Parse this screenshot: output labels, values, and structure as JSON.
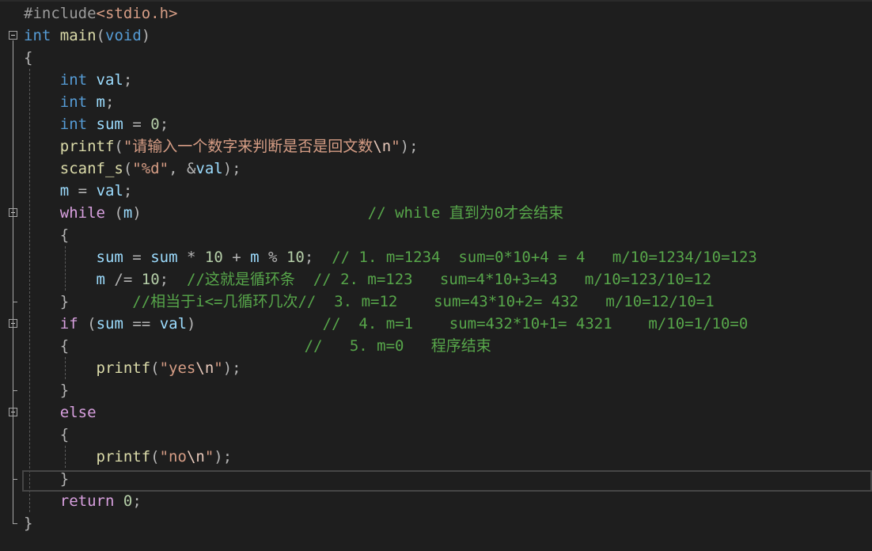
{
  "editor": {
    "language": "C",
    "lines": [
      {
        "seg": [
          [
            "pp",
            "#include"
          ],
          [
            "inc",
            "<stdio.h>"
          ]
        ]
      },
      {
        "seg": [
          [
            "kw",
            "int"
          ],
          [
            "txt",
            " "
          ],
          [
            "fn",
            "main"
          ],
          [
            "punc",
            "("
          ],
          [
            "kw",
            "void"
          ],
          [
            "punc",
            ")"
          ]
        ]
      },
      {
        "seg": [
          [
            "punc",
            "{"
          ]
        ]
      },
      {
        "seg": [
          [
            "txt",
            "    "
          ],
          [
            "kw",
            "int"
          ],
          [
            "txt",
            " "
          ],
          [
            "var",
            "val"
          ],
          [
            "punc",
            ";"
          ]
        ]
      },
      {
        "seg": [
          [
            "txt",
            "    "
          ],
          [
            "kw",
            "int"
          ],
          [
            "txt",
            " "
          ],
          [
            "var",
            "m"
          ],
          [
            "punc",
            ";"
          ]
        ]
      },
      {
        "seg": [
          [
            "txt",
            "    "
          ],
          [
            "kw",
            "int"
          ],
          [
            "txt",
            " "
          ],
          [
            "var",
            "sum"
          ],
          [
            "txt",
            " "
          ],
          [
            "punc",
            "="
          ],
          [
            "txt",
            " "
          ],
          [
            "num",
            "0"
          ],
          [
            "punc",
            ";"
          ]
        ]
      },
      {
        "seg": [
          [
            "txt",
            "    "
          ],
          [
            "fn",
            "printf"
          ],
          [
            "punc",
            "("
          ],
          [
            "str",
            "\"请输入一个数字来判断是否是回文数"
          ],
          [
            "esc",
            "\\n"
          ],
          [
            "str",
            "\""
          ],
          [
            "punc",
            ");"
          ]
        ]
      },
      {
        "seg": [
          [
            "txt",
            "    "
          ],
          [
            "fn",
            "scanf_s"
          ],
          [
            "punc",
            "("
          ],
          [
            "str",
            "\"%d\""
          ],
          [
            "punc",
            ", &"
          ],
          [
            "var",
            "val"
          ],
          [
            "punc",
            ");"
          ]
        ]
      },
      {
        "seg": [
          [
            "txt",
            "    "
          ],
          [
            "var",
            "m"
          ],
          [
            "txt",
            " "
          ],
          [
            "punc",
            "="
          ],
          [
            "txt",
            " "
          ],
          [
            "var",
            "val"
          ],
          [
            "punc",
            ";"
          ]
        ]
      },
      {
        "seg": [
          [
            "txt",
            "    "
          ],
          [
            "kw2",
            "while"
          ],
          [
            "txt",
            " "
          ],
          [
            "punc",
            "("
          ],
          [
            "var",
            "m"
          ],
          [
            "punc",
            ")"
          ],
          [
            "txt",
            "                         "
          ],
          [
            "cm",
            "// while 直到为0才会结束"
          ]
        ]
      },
      {
        "seg": [
          [
            "txt",
            "    "
          ],
          [
            "punc",
            "{"
          ]
        ]
      },
      {
        "seg": [
          [
            "txt",
            "        "
          ],
          [
            "var",
            "sum"
          ],
          [
            "txt",
            " "
          ],
          [
            "punc",
            "="
          ],
          [
            "txt",
            " "
          ],
          [
            "var",
            "sum"
          ],
          [
            "txt",
            " "
          ],
          [
            "punc",
            "*"
          ],
          [
            "txt",
            " "
          ],
          [
            "num",
            "10"
          ],
          [
            "txt",
            " "
          ],
          [
            "punc",
            "+"
          ],
          [
            "txt",
            " "
          ],
          [
            "var",
            "m"
          ],
          [
            "txt",
            " "
          ],
          [
            "punc",
            "%"
          ],
          [
            "txt",
            " "
          ],
          [
            "num",
            "10"
          ],
          [
            "punc",
            ";"
          ],
          [
            "txt",
            "  "
          ],
          [
            "cm",
            "// 1. m=1234  sum=0*10+4 = 4   m/10=1234/10=123"
          ]
        ]
      },
      {
        "seg": [
          [
            "txt",
            "        "
          ],
          [
            "var",
            "m"
          ],
          [
            "txt",
            " "
          ],
          [
            "punc",
            "/="
          ],
          [
            "txt",
            " "
          ],
          [
            "num",
            "10"
          ],
          [
            "punc",
            ";"
          ],
          [
            "txt",
            "  "
          ],
          [
            "cm",
            "//这就是循环条  // 2. m=123   sum=4*10+3=43   m/10=123/10=12"
          ]
        ]
      },
      {
        "seg": [
          [
            "txt",
            "    "
          ],
          [
            "punc",
            "}"
          ],
          [
            "txt",
            "       "
          ],
          [
            "cm",
            "//相当于i<=几循环几次//  3. m=12    sum=43*10+2= 432   m/10=12/10=1"
          ]
        ]
      },
      {
        "seg": [
          [
            "txt",
            "    "
          ],
          [
            "kw2",
            "if"
          ],
          [
            "txt",
            " "
          ],
          [
            "punc",
            "("
          ],
          [
            "var",
            "sum"
          ],
          [
            "txt",
            " "
          ],
          [
            "punc",
            "=="
          ],
          [
            "txt",
            " "
          ],
          [
            "var",
            "val"
          ],
          [
            "punc",
            ")"
          ],
          [
            "txt",
            "              "
          ],
          [
            "cm",
            "//  4. m=1    sum=432*10+1= 4321    m/10=1/10=0"
          ]
        ]
      },
      {
        "seg": [
          [
            "txt",
            "    "
          ],
          [
            "punc",
            "{"
          ],
          [
            "txt",
            "                          "
          ],
          [
            "cm",
            "//   5. m=0   程序结束"
          ]
        ]
      },
      {
        "seg": [
          [
            "txt",
            "        "
          ],
          [
            "fn",
            "printf"
          ],
          [
            "punc",
            "("
          ],
          [
            "str",
            "\"yes"
          ],
          [
            "esc",
            "\\n"
          ],
          [
            "str",
            "\""
          ],
          [
            "punc",
            ");"
          ]
        ]
      },
      {
        "seg": [
          [
            "txt",
            "    "
          ],
          [
            "punc",
            "}"
          ]
        ]
      },
      {
        "seg": [
          [
            "txt",
            "    "
          ],
          [
            "kw2",
            "else"
          ]
        ]
      },
      {
        "seg": [
          [
            "txt",
            "    "
          ],
          [
            "punc",
            "{"
          ]
        ]
      },
      {
        "seg": [
          [
            "txt",
            "        "
          ],
          [
            "fn",
            "printf"
          ],
          [
            "punc",
            "("
          ],
          [
            "str",
            "\"no"
          ],
          [
            "esc",
            "\\n"
          ],
          [
            "str",
            "\""
          ],
          [
            "punc",
            ");"
          ]
        ]
      },
      {
        "seg": [
          [
            "txt",
            "    "
          ],
          [
            "punc",
            "}"
          ]
        ]
      },
      {
        "seg": [
          [
            "txt",
            "    "
          ],
          [
            "kw2",
            "return"
          ],
          [
            "txt",
            " "
          ],
          [
            "num",
            "0"
          ],
          [
            "punc",
            ";"
          ]
        ]
      },
      {
        "seg": [
          [
            "punc",
            "}"
          ]
        ]
      }
    ],
    "fold_markers": [
      {
        "line": 1,
        "state": "expanded"
      },
      {
        "line": 9,
        "state": "expanded"
      },
      {
        "line": 14,
        "state": "expanded"
      },
      {
        "line": 18,
        "state": "expanded"
      }
    ],
    "current_line": 21
  }
}
